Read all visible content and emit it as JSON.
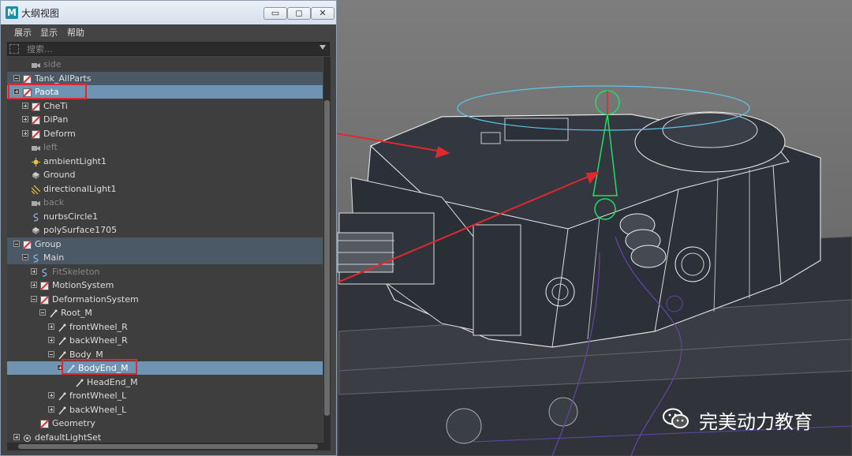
{
  "window": {
    "title": "大纲视图",
    "logo_letter": "M",
    "minimize_symbol": "▭",
    "restore_symbol": "◻",
    "close_symbol": "✕"
  },
  "menu": [
    "展示",
    "显示",
    "帮助"
  ],
  "search": {
    "placeholder": "搜索..."
  },
  "tree": [
    {
      "label": "side",
      "icon": "camera-icon",
      "dim": true
    },
    {
      "label": "Tank_AllParts",
      "icon": "group-transform-icon",
      "expander": "minus",
      "group": true
    },
    {
      "label": "Paota",
      "icon": "group-transform-icon",
      "expander": "plus",
      "selected": true
    },
    {
      "label": "CheTi",
      "icon": "group-transform-icon",
      "expander": "plus"
    },
    {
      "label": "DiPan",
      "icon": "group-transform-icon",
      "expander": "plus"
    },
    {
      "label": "Deform",
      "icon": "group-transform-icon",
      "expander": "plus"
    },
    {
      "label": "left",
      "icon": "camera-icon",
      "dim": true
    },
    {
      "label": "ambientLight1",
      "icon": "ambient-light-icon"
    },
    {
      "label": "Ground",
      "icon": "mesh-icon"
    },
    {
      "label": "directionalLight1",
      "icon": "directional-light-icon"
    },
    {
      "label": "back",
      "icon": "camera-icon",
      "dim": true
    },
    {
      "label": "nurbsCircle1",
      "icon": "nurbs-curve-icon"
    },
    {
      "label": "polySurface1705",
      "icon": "mesh-icon"
    },
    {
      "label": "Group",
      "icon": "group-transform-icon",
      "expander": "minus",
      "group": true
    },
    {
      "label": "Main",
      "icon": "nurbs-curve-icon",
      "expander": "minus",
      "group": true
    },
    {
      "label": "FitSkeleton",
      "icon": "nurbs-curve-icon",
      "expander": "plus",
      "dim": true
    },
    {
      "label": "MotionSystem",
      "icon": "group-transform-icon",
      "expander": "plus"
    },
    {
      "label": "DeformationSystem",
      "icon": "group-transform-icon",
      "expander": "minus"
    },
    {
      "label": "Root_M",
      "icon": "joint-icon",
      "expander": "minus"
    },
    {
      "label": "frontWheel_R",
      "icon": "joint-icon",
      "expander": "plus"
    },
    {
      "label": "backWheel_R",
      "icon": "joint-icon",
      "expander": "plus"
    },
    {
      "label": "Body_M",
      "icon": "joint-icon",
      "expander": "minus"
    },
    {
      "label": "BodyEnd_M",
      "icon": "joint-icon",
      "expander": "plus",
      "selected": true
    },
    {
      "label": "HeadEnd_M",
      "icon": "joint-icon"
    },
    {
      "label": "frontWheel_L",
      "icon": "joint-icon",
      "expander": "plus"
    },
    {
      "label": "backWheel_L",
      "icon": "joint-icon",
      "expander": "plus"
    },
    {
      "label": "Geometry",
      "icon": "group-transform-icon"
    },
    {
      "label": "defaultLightSet",
      "icon": "light-set-icon",
      "expander": "plus"
    }
  ],
  "watermark": {
    "text": "完美动力教育",
    "icon": "wechat-icon"
  },
  "colors": {
    "selection": "#6e93b3",
    "annotation": "#e0282e",
    "manipulator": "#22dd66"
  }
}
